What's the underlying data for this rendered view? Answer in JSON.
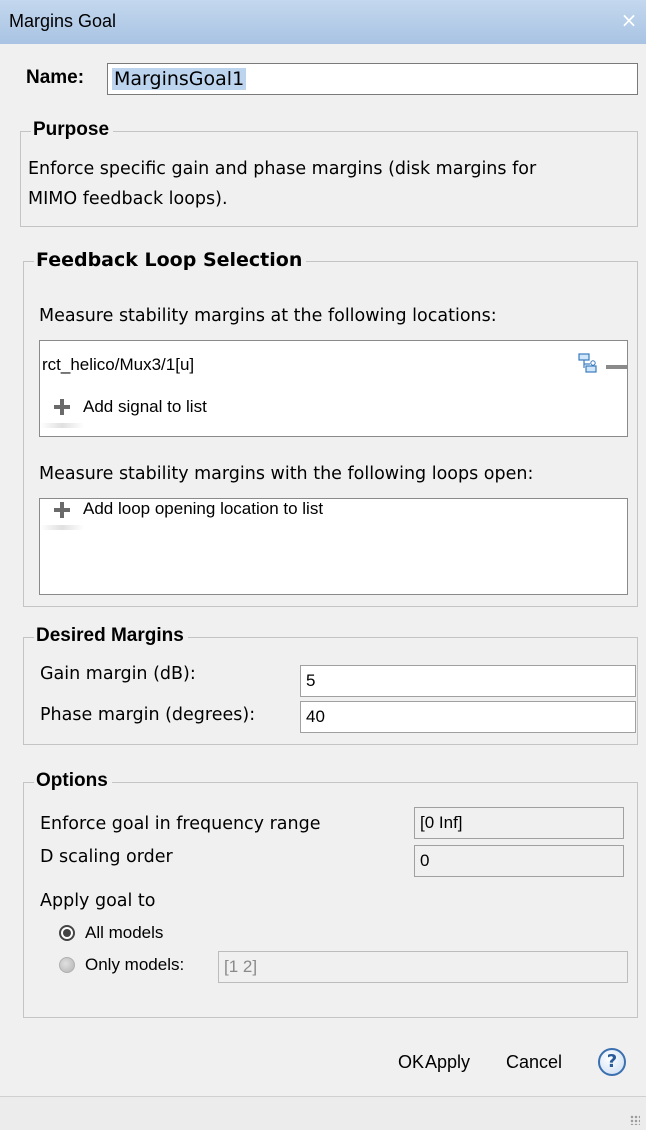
{
  "window": {
    "title": "Margins Goal",
    "close_symbol": "×"
  },
  "name": {
    "label": "Name:",
    "value": "MarginsGoal1"
  },
  "purpose": {
    "legend": "Purpose",
    "line1": "Enforce specific gain and phase margins (disk margins for",
    "line2": "MIMO feedback loops)."
  },
  "feedback": {
    "legend": "Feedback Loop Selection",
    "locations_label": "Measure stability margins at the following locations:",
    "signals": [
      "rct_helico/Mux3/1[u]"
    ],
    "add_signal_label": "Add signal to list",
    "openings_label": "Measure stability margins with the following loops open:",
    "add_opening_label": "Add loop opening location to list"
  },
  "margins": {
    "legend": "Desired Margins",
    "gain_label": "Gain margin (dB):",
    "gain_value": "5",
    "phase_label": "Phase margin (degrees):",
    "phase_value": "40"
  },
  "options": {
    "legend": "Options",
    "freq_label": "Enforce goal in frequency range",
    "freq_value": "[0 Inf]",
    "dscale_label": "D scaling order",
    "dscale_value": "0",
    "apply_label": "Apply goal to",
    "all_models_label": "All models",
    "only_models_label": "Only models:",
    "only_models_value": "[1 2]",
    "selected": "All models"
  },
  "buttons": {
    "ok": "OK",
    "apply": "Apply",
    "cancel": "Cancel",
    "help": "?"
  }
}
